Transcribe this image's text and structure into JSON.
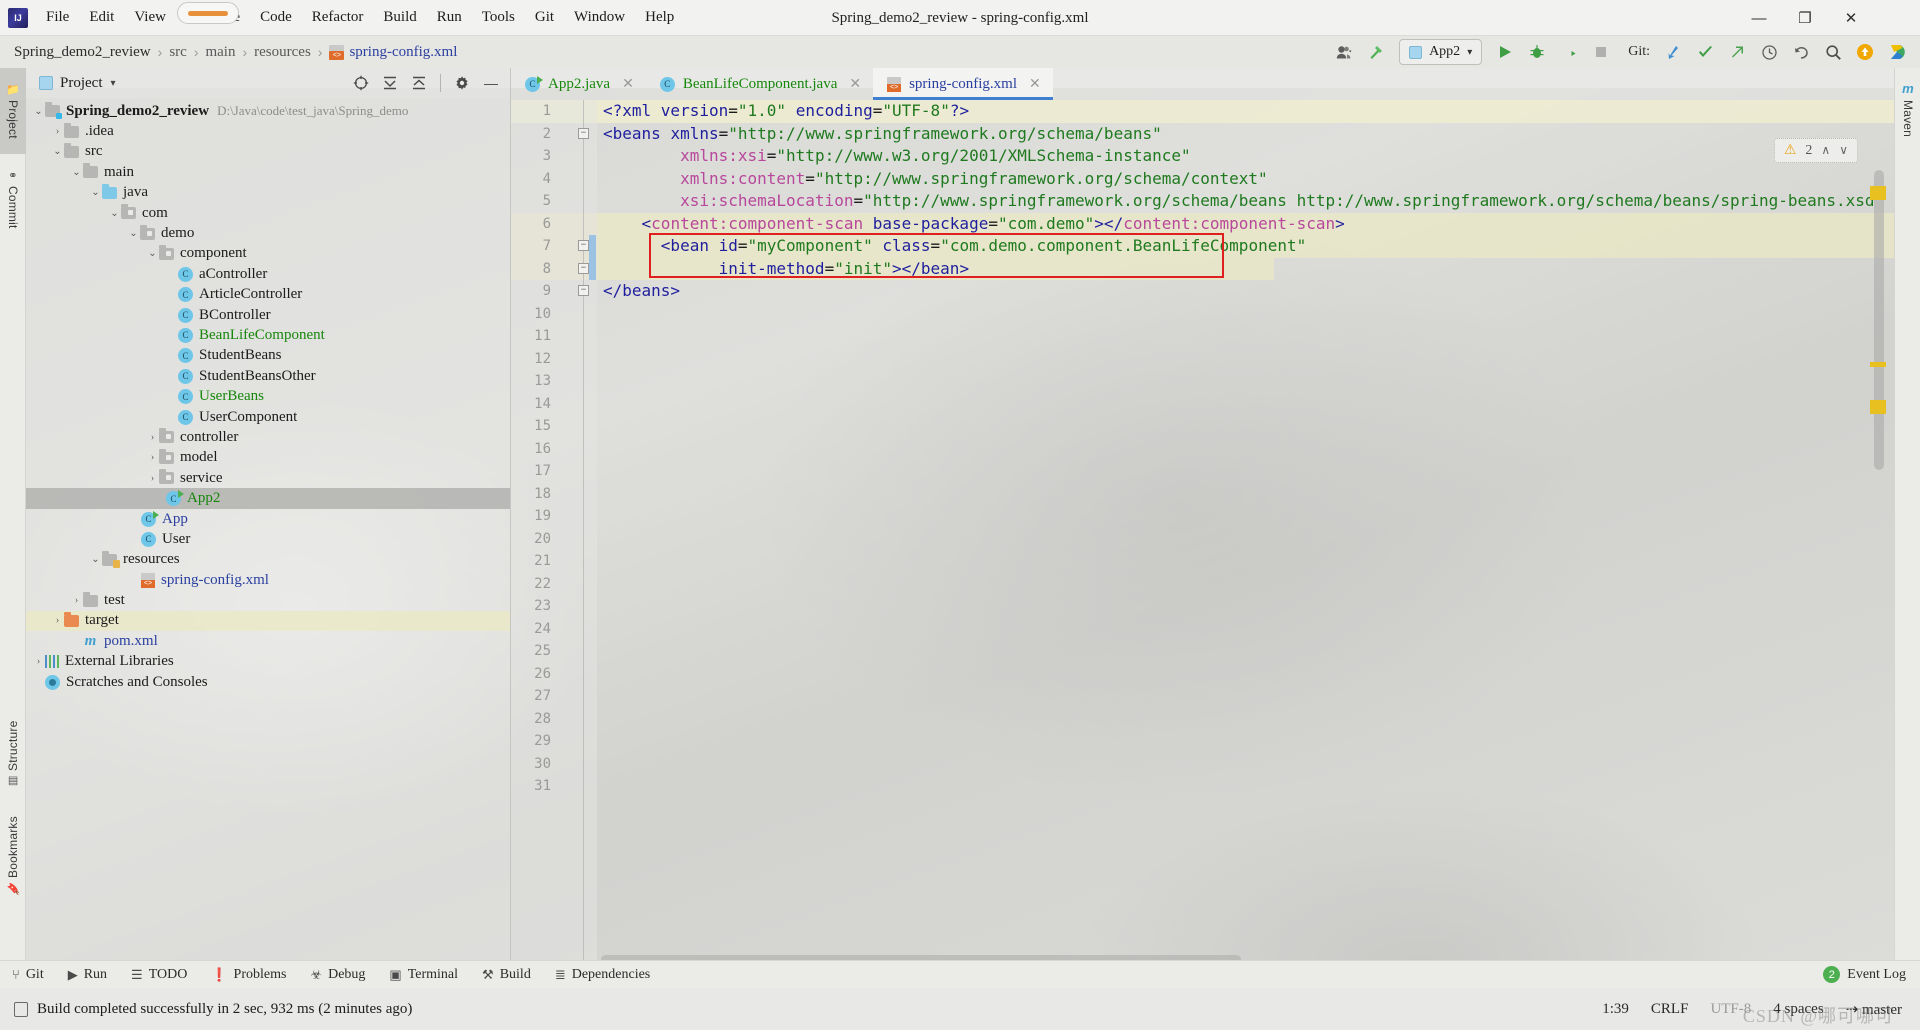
{
  "window": {
    "title": "Spring_demo2_review - spring-config.xml",
    "minimize_label": "—",
    "maximize_label": "❐",
    "close_label": "✕"
  },
  "menubar": {
    "logo_label": "IJ",
    "items": [
      {
        "label": "File"
      },
      {
        "label": "Edit"
      },
      {
        "label": "View"
      },
      {
        "label": "Navigate"
      },
      {
        "label": "Code"
      },
      {
        "label": "Refactor"
      },
      {
        "label": "Build"
      },
      {
        "label": "Run"
      },
      {
        "label": "Tools"
      },
      {
        "label": "Git"
      },
      {
        "label": "Window"
      },
      {
        "label": "Help"
      }
    ]
  },
  "breadcrumb": {
    "items": [
      {
        "label": "Spring_demo2_review",
        "style": "dark"
      },
      {
        "label": "src",
        "style": "muted"
      },
      {
        "label": "main",
        "style": "muted"
      },
      {
        "label": "resources",
        "style": "muted"
      },
      {
        "label": "spring-config.xml",
        "style": "link",
        "icon": "xml-file-icon"
      }
    ],
    "separator": "›"
  },
  "toolbar": {
    "account_icon": "user-account-icon",
    "account_caret": "▾",
    "build_icon": "hammer-build-icon",
    "run_config": {
      "name": "App2",
      "caret": "▾",
      "icon": "run-config-icon"
    },
    "run_icon": "run-play-icon",
    "debug_icon": "debug-bug-icon",
    "coverage_icon": "run-with-coverage-icon",
    "stop_icon": "stop-icon",
    "git_label": "Git:",
    "git_update_icon": "update-project-icon",
    "git_commit_icon": "commit-check-icon",
    "git_push_icon": "push-arrow-icon",
    "git_history_icon": "history-clock-icon",
    "git_rollback_icon": "rollback-undo-icon",
    "search_icon": "search-magnifier-icon",
    "updates_icon": "updates-available-icon",
    "ide_icon": "ide-assistant-icon"
  },
  "rails": {
    "left": [
      {
        "label": "Project",
        "icon": "project-folder-icon",
        "selected": true
      },
      {
        "label": "Commit",
        "icon": "commit-icon",
        "selected": false
      },
      {
        "label": "Structure",
        "icon": "structure-icon",
        "selected": false
      },
      {
        "label": "Bookmarks",
        "icon": "bookmark-icon",
        "selected": false
      }
    ],
    "right": [
      {
        "label": "Maven",
        "icon": "maven-m-icon",
        "selected": false
      }
    ]
  },
  "project_panel": {
    "title": "Project",
    "title_caret": "▾",
    "tools": [
      {
        "name": "select-opened-file-icon",
        "glyph": "⊕"
      },
      {
        "name": "expand-all-icon",
        "glyph": "⩯"
      },
      {
        "name": "collapse-all-icon",
        "glyph": "⩰"
      },
      {
        "name": "settings-gear-icon",
        "glyph": "⚙"
      },
      {
        "name": "hide-panel-icon",
        "glyph": "—"
      }
    ],
    "tree": [
      {
        "depth": 0,
        "arrow": "⌄",
        "icon": "module-folder-icon",
        "label": "Spring_demo2_review",
        "path": "D:\\Java\\code\\test_java\\Spring_demo",
        "bold": true,
        "color": "dark"
      },
      {
        "depth": 1,
        "arrow": "›",
        "icon": "folder-icon",
        "label": ".idea",
        "color": "dark"
      },
      {
        "depth": 1,
        "arrow": "⌄",
        "icon": "folder-icon",
        "label": "src",
        "color": "dark"
      },
      {
        "depth": 2,
        "arrow": "⌄",
        "icon": "folder-icon",
        "label": "main",
        "color": "dark"
      },
      {
        "depth": 3,
        "arrow": "⌄",
        "icon": "source-folder-icon",
        "label": "java",
        "color": "dark"
      },
      {
        "depth": 4,
        "arrow": "⌄",
        "icon": "package-icon",
        "label": "com",
        "color": "dark"
      },
      {
        "depth": 5,
        "arrow": "⌄",
        "icon": "package-icon",
        "label": "demo",
        "color": "dark"
      },
      {
        "depth": 6,
        "arrow": "⌄",
        "icon": "package-icon",
        "label": "component",
        "color": "dark"
      },
      {
        "depth": 7,
        "arrow": "",
        "icon": "java-class-icon",
        "label": "aController",
        "color": "dark"
      },
      {
        "depth": 7,
        "arrow": "",
        "icon": "java-class-icon",
        "label": "ArticleController",
        "color": "dark"
      },
      {
        "depth": 7,
        "arrow": "",
        "icon": "java-class-icon",
        "label": "BController",
        "color": "dark"
      },
      {
        "depth": 7,
        "arrow": "",
        "icon": "java-class-icon",
        "label": "BeanLifeComponent",
        "color": "green"
      },
      {
        "depth": 7,
        "arrow": "",
        "icon": "java-class-icon",
        "label": "StudentBeans",
        "color": "dark"
      },
      {
        "depth": 7,
        "arrow": "",
        "icon": "java-class-icon",
        "label": "StudentBeansOther",
        "color": "dark"
      },
      {
        "depth": 7,
        "arrow": "",
        "icon": "java-class-icon",
        "label": "UserBeans",
        "color": "green"
      },
      {
        "depth": 7,
        "arrow": "",
        "icon": "java-class-icon",
        "label": "UserComponent",
        "color": "dark"
      },
      {
        "depth": 6,
        "arrow": "›",
        "icon": "package-icon",
        "label": "controller",
        "color": "dark"
      },
      {
        "depth": 6,
        "arrow": "›",
        "icon": "package-icon",
        "label": "model",
        "color": "dark"
      },
      {
        "depth": 6,
        "arrow": "›",
        "icon": "package-icon",
        "label": "service",
        "color": "dark"
      },
      {
        "depth": 6,
        "arrow": "",
        "icon": "java-runnable-class-icon",
        "label": "App2",
        "color": "green",
        "selected": true
      },
      {
        "depth": 5,
        "arrow": "",
        "icon": "java-runnable-class-icon",
        "label": "App",
        "color": "blue"
      },
      {
        "depth": 5,
        "arrow": "",
        "icon": "java-class-icon",
        "label": "User",
        "color": "dark"
      },
      {
        "depth": 3,
        "arrow": "⌄",
        "icon": "resources-folder-icon",
        "label": "resources",
        "color": "dark"
      },
      {
        "depth": 4,
        "arrow": "",
        "icon": "xml-file-icon",
        "label": "spring-config.xml",
        "color": "blue"
      },
      {
        "depth": 2,
        "arrow": "›",
        "icon": "folder-icon",
        "label": "test",
        "color": "dark"
      },
      {
        "depth": 1,
        "arrow": "›",
        "icon": "excluded-folder-icon",
        "label": "target",
        "color": "dark",
        "highlighted": true
      },
      {
        "depth": 1,
        "arrow": "",
        "icon": "maven-pom-icon",
        "label": "pom.xml",
        "color": "blue"
      },
      {
        "depth": 0,
        "arrow": "›",
        "icon": "external-libraries-icon",
        "label": "External Libraries",
        "color": "dark"
      },
      {
        "depth": 0,
        "arrow": "",
        "icon": "scratches-icon",
        "label": "Scratches and Consoles",
        "color": "dark"
      }
    ]
  },
  "editor": {
    "tabs": [
      {
        "label": "App2.java",
        "icon": "java-runnable-class-icon",
        "color": "green",
        "active": false,
        "close": "✕"
      },
      {
        "label": "BeanLifeComponent.java",
        "icon": "java-class-icon",
        "color": "green",
        "active": false,
        "close": "✕"
      },
      {
        "label": "spring-config.xml",
        "icon": "xml-file-icon",
        "color": "blue",
        "active": true,
        "close": "✕"
      }
    ],
    "line_numbers": [
      1,
      2,
      3,
      4,
      5,
      6,
      7,
      8,
      9,
      10,
      11,
      12,
      13,
      14,
      15,
      16,
      17,
      18,
      19,
      20,
      21,
      22,
      23,
      24,
      25,
      26,
      27,
      28,
      29,
      30,
      31
    ],
    "warnings": {
      "icon": "warning-triangle-icon",
      "count": "2",
      "prev": "∧",
      "next": "∨"
    },
    "code_lines": [
      {
        "line": 1,
        "indent": 0,
        "tokens": [
          {
            "t": "<?xml ",
            "c": "pi"
          },
          {
            "t": "version",
            "c": "attr"
          },
          {
            "t": "=",
            "c": "plain"
          },
          {
            "t": "\"1.0\"",
            "c": "str"
          },
          {
            "t": " ",
            "c": "plain"
          },
          {
            "t": "encoding",
            "c": "attr"
          },
          {
            "t": "=",
            "c": "plain"
          },
          {
            "t": "\"UTF-8\"",
            "c": "str"
          },
          {
            "t": "?>",
            "c": "pi"
          }
        ]
      },
      {
        "line": 2,
        "indent": 0,
        "tokens": [
          {
            "t": "<beans ",
            "c": "tag"
          },
          {
            "t": "xmlns",
            "c": "attr"
          },
          {
            "t": "=",
            "c": "plain"
          },
          {
            "t": "\"http://www.springframework.org/schema/beans\"",
            "c": "str"
          }
        ]
      },
      {
        "line": 3,
        "indent": 8,
        "tokens": [
          {
            "t": "xmlns:xsi",
            "c": "pink"
          },
          {
            "t": "=",
            "c": "plain"
          },
          {
            "t": "\"http://www.w3.org/2001/XMLSchema-instance\"",
            "c": "str"
          }
        ]
      },
      {
        "line": 4,
        "indent": 8,
        "tokens": [
          {
            "t": "xmlns:content",
            "c": "pink"
          },
          {
            "t": "=",
            "c": "plain"
          },
          {
            "t": "\"http://www.springframework.org/schema/context\"",
            "c": "str"
          }
        ]
      },
      {
        "line": 5,
        "indent": 8,
        "tokens": [
          {
            "t": "xsi:schemaLocation",
            "c": "pink"
          },
          {
            "t": "=",
            "c": "plain"
          },
          {
            "t": "\"http://www.springframework.org/schema/beans http://www.springframework.org/schema/beans/spring-beans.xsd\"",
            "c": "str"
          }
        ]
      },
      {
        "line": 6,
        "indent": 4,
        "tokens": [
          {
            "t": "<",
            "c": "tag"
          },
          {
            "t": "content:component-scan",
            "c": "pink"
          },
          {
            "t": " ",
            "c": "plain"
          },
          {
            "t": "base-package",
            "c": "attr"
          },
          {
            "t": "=",
            "c": "plain"
          },
          {
            "t": "\"com.demo\"",
            "c": "str"
          },
          {
            "t": ">",
            "c": "tag"
          },
          {
            "t": "</",
            "c": "tag"
          },
          {
            "t": "content:component-scan",
            "c": "pink"
          },
          {
            "t": ">",
            "c": "tag"
          }
        ]
      },
      {
        "line": 7,
        "indent": 6,
        "tokens": [
          {
            "t": "<bean ",
            "c": "tag"
          },
          {
            "t": "id",
            "c": "attr"
          },
          {
            "t": "=",
            "c": "plain"
          },
          {
            "t": "\"myComponent\"",
            "c": "str"
          },
          {
            "t": " ",
            "c": "plain"
          },
          {
            "t": "class",
            "c": "attr"
          },
          {
            "t": "=",
            "c": "plain"
          },
          {
            "t": "\"com.demo.component.BeanLifeComponent\"",
            "c": "str"
          }
        ]
      },
      {
        "line": 8,
        "indent": 12,
        "tokens": [
          {
            "t": "init-method",
            "c": "attr"
          },
          {
            "t": "=",
            "c": "plain"
          },
          {
            "t": "\"init\"",
            "c": "str"
          },
          {
            "t": ">",
            "c": "tag"
          },
          {
            "t": "</",
            "c": "tag"
          },
          {
            "t": "bean",
            "c": "tag"
          },
          {
            "t": ">",
            "c": "tag"
          }
        ]
      },
      {
        "line": 9,
        "indent": 0,
        "tokens": [
          {
            "t": "</beans>",
            "c": "tag"
          }
        ]
      }
    ],
    "highlighted_lines": [
      1,
      6,
      7,
      8
    ],
    "changed_lines": [
      7,
      8
    ],
    "red_highlight_lines": [
      7,
      8
    ]
  },
  "bottom_bar": {
    "items": [
      {
        "label": "Git",
        "icon": "git-branch-icon",
        "glyph": "⑂"
      },
      {
        "label": "Run",
        "icon": "run-play-icon",
        "glyph": "▶"
      },
      {
        "label": "TODO",
        "icon": "todo-list-icon",
        "glyph": "☰"
      },
      {
        "label": "Problems",
        "icon": "problems-icon",
        "glyph": "❗"
      },
      {
        "label": "Debug",
        "icon": "debug-bug-icon",
        "glyph": "☣"
      },
      {
        "label": "Terminal",
        "icon": "terminal-icon",
        "glyph": "▣"
      },
      {
        "label": "Build",
        "icon": "hammer-build-icon",
        "glyph": "⚒"
      },
      {
        "label": "Dependencies",
        "icon": "dependencies-icon",
        "glyph": "≣"
      }
    ],
    "event_log": {
      "label": "Event Log",
      "count": "2"
    }
  },
  "status_bar": {
    "message": "Build completed successfully in 2 sec, 932 ms (2 minutes ago)",
    "message_icon": "notification-icon",
    "caret_position": "1:39",
    "line_separator": "CRLF",
    "encoding": "UTF-8",
    "indent": "4 spaces",
    "branch": "master",
    "branch_icon": "git-branch-icon"
  },
  "watermark": "CSDN @哪可哪可"
}
